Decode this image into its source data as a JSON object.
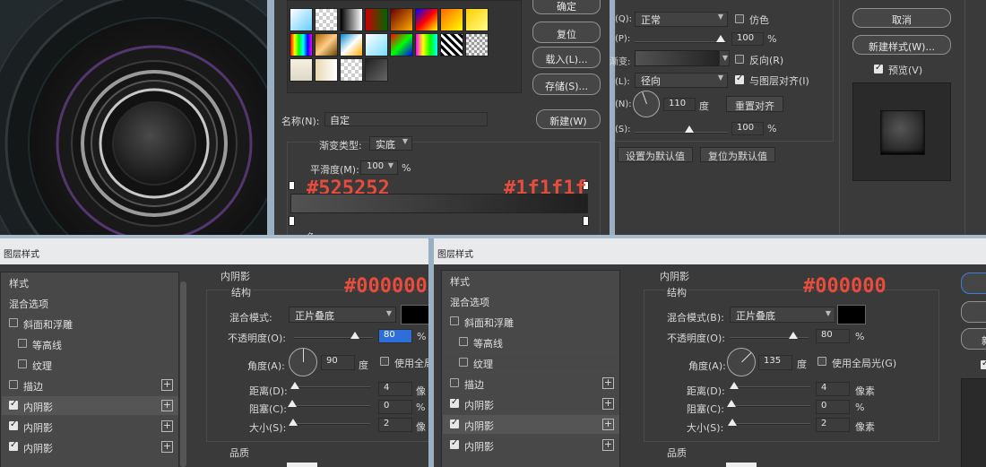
{
  "gradient_panel": {
    "buttons": [
      "确定",
      "复位",
      "载入(L)...",
      "存储(S)...",
      "新建(W)"
    ],
    "name_label": "名称(N):",
    "name_value": "自定",
    "type_label": "渐变类型:",
    "type_value": "实底",
    "smooth_label": "平滑度(M):",
    "smooth_value": "100",
    "smooth_unit": "%",
    "left_color": "#525252",
    "right_color": "#1f1f1f",
    "truncated_label": "色"
  },
  "gradient_overlay": {
    "blend_label": "(Q):",
    "blend_value": "正常",
    "dither_label": "仿色",
    "opacity_label": "(P):",
    "opacity_value": "100",
    "opacity_unit": "%",
    "gradient_label": "渐变:",
    "reverse_label": "反向(R)",
    "style_label": "(L):",
    "style_value": "径向",
    "align_label": "与图层对齐(I)",
    "angle_label": "(N):",
    "angle_value": "110",
    "angle_unit": "度",
    "reset_align": "重置对齐",
    "scale_label": "(S):",
    "scale_value": "100",
    "scale_unit": "%",
    "set_default": "设置为默认值",
    "reset_default": "复位为默认值"
  },
  "right_panel": {
    "cancel": "取消",
    "new_style": "新建样式(W)...",
    "preview": "预览(V)"
  },
  "dialog_left": {
    "title": "图层样式",
    "sidebar": [
      {
        "label": "样式",
        "checkbox": false,
        "checked": false,
        "plus": false,
        "indent": false
      },
      {
        "label": "混合选项",
        "checkbox": false,
        "checked": false,
        "plus": false,
        "indent": false
      },
      {
        "label": "斜面和浮雕",
        "checkbox": true,
        "checked": false,
        "plus": false,
        "indent": false
      },
      {
        "label": "等高线",
        "checkbox": true,
        "checked": false,
        "plus": false,
        "indent": true
      },
      {
        "label": "纹理",
        "checkbox": true,
        "checked": false,
        "plus": false,
        "indent": true
      },
      {
        "label": "描边",
        "checkbox": true,
        "checked": false,
        "plus": true,
        "indent": false
      },
      {
        "label": "内阴影",
        "checkbox": true,
        "checked": true,
        "plus": true,
        "indent": false
      },
      {
        "label": "内阴影",
        "checkbox": true,
        "checked": true,
        "plus": true,
        "indent": false
      },
      {
        "label": "内阴影",
        "checkbox": true,
        "checked": true,
        "plus": true,
        "indent": false
      }
    ],
    "section_title": "内阴影",
    "structure": "结构",
    "color_hex": "#000000",
    "blend_label": "混合模式:",
    "blend_value": "正片叠底",
    "opacity_label": "不透明度(O):",
    "opacity_value": "80",
    "opacity_unit": "%",
    "angle_label": "角度(A):",
    "angle_value": "90",
    "angle_unit": "度",
    "global_light": "使用全局",
    "distance_label": "距离(D):",
    "distance_value": "4",
    "distance_unit": "像",
    "choke_label": "阻塞(C):",
    "choke_value": "0",
    "choke_unit": "%",
    "size_label": "大小(S):",
    "size_value": "2",
    "size_unit": "像",
    "quality": "品质"
  },
  "dialog_right": {
    "title": "图层样式",
    "sidebar": [
      {
        "label": "样式",
        "checkbox": false,
        "checked": false,
        "plus": false,
        "indent": false
      },
      {
        "label": "混合选项",
        "checkbox": false,
        "checked": false,
        "plus": false,
        "indent": false
      },
      {
        "label": "斜面和浮雕",
        "checkbox": true,
        "checked": false,
        "plus": false,
        "indent": false
      },
      {
        "label": "等高线",
        "checkbox": true,
        "checked": false,
        "plus": false,
        "indent": true
      },
      {
        "label": "纹理",
        "checkbox": true,
        "checked": false,
        "plus": false,
        "indent": true
      },
      {
        "label": "描边",
        "checkbox": true,
        "checked": false,
        "plus": true,
        "indent": false
      },
      {
        "label": "内阴影",
        "checkbox": true,
        "checked": true,
        "plus": true,
        "indent": false
      },
      {
        "label": "内阴影",
        "checkbox": true,
        "checked": true,
        "plus": true,
        "indent": false
      },
      {
        "label": "内阴影",
        "checkbox": true,
        "checked": true,
        "plus": true,
        "indent": false
      }
    ],
    "section_title": "内阴影",
    "structure": "结构",
    "color_hex": "#000000",
    "blend_label": "混合模式(B):",
    "blend_value": "正片叠底",
    "opacity_label": "不透明度(O):",
    "opacity_value": "80",
    "opacity_unit": "%",
    "angle_label": "角度(A):",
    "angle_value": "135",
    "angle_unit": "度",
    "global_light": "使用全局光(G)",
    "distance_label": "距离(D):",
    "distance_value": "4",
    "distance_unit": "像素",
    "choke_label": "阻塞(C):",
    "choke_value": "0",
    "choke_unit": "%",
    "size_label": "大小(S):",
    "size_value": "2",
    "size_unit": "像素",
    "quality": "品质",
    "cut_button": "新"
  }
}
